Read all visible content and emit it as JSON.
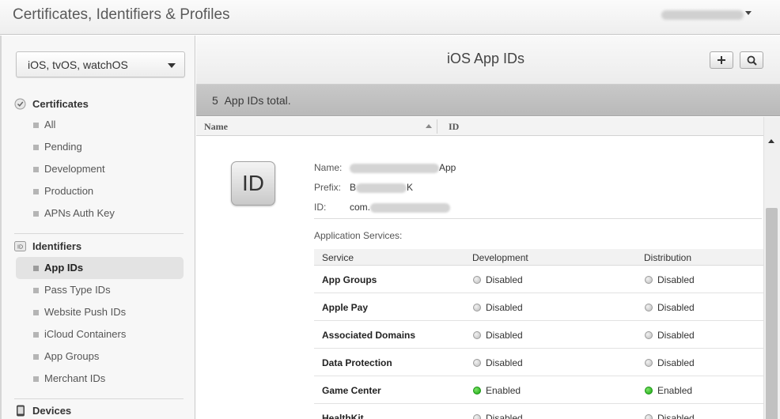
{
  "header": {
    "title": "Certificates, Identifiers & Profiles"
  },
  "sidebar": {
    "platform": "iOS, tvOS, watchOS",
    "sections": [
      {
        "label": "Certificates",
        "items": [
          "All",
          "Pending",
          "Development",
          "Production",
          "APNs Auth Key"
        ]
      },
      {
        "label": "Identifiers",
        "items": [
          "App IDs",
          "Pass Type IDs",
          "Website Push IDs",
          "iCloud Containers",
          "App Groups",
          "Merchant IDs"
        ]
      },
      {
        "label": "Devices"
      }
    ],
    "active_item": "App IDs"
  },
  "main": {
    "title": "iOS App IDs",
    "count": "5",
    "count_label": "App IDs total.",
    "columns": {
      "name": "Name",
      "id": "ID"
    },
    "detail": {
      "icon_text": "ID",
      "name_label": "Name:",
      "name_suffix": "App",
      "prefix_label": "Prefix:",
      "prefix_start": "B",
      "prefix_end": "K",
      "id_label": "ID:",
      "id_value": "com.",
      "services_title": "Application Services:",
      "table_headers": {
        "service": "Service",
        "development": "Development",
        "distribution": "Distribution"
      },
      "services": [
        {
          "name": "App Groups",
          "development": "Disabled",
          "distribution": "Disabled"
        },
        {
          "name": "Apple Pay",
          "development": "Disabled",
          "distribution": "Disabled"
        },
        {
          "name": "Associated Domains",
          "development": "Disabled",
          "distribution": "Disabled"
        },
        {
          "name": "Data Protection",
          "development": "Disabled",
          "distribution": "Disabled"
        },
        {
          "name": "Game Center",
          "development": "Enabled",
          "distribution": "Enabled"
        },
        {
          "name": "HealthKit",
          "development": "Disabled",
          "distribution": "Disabled"
        }
      ]
    }
  },
  "colors": {
    "enabled": "#1ba80f",
    "disabled": "#bdbdbd"
  }
}
